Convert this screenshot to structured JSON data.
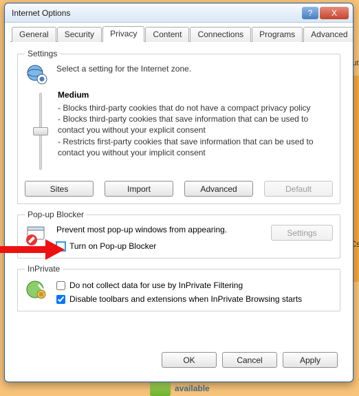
{
  "window": {
    "title": "Internet Options",
    "help": "?",
    "close": "X"
  },
  "tabs": [
    "General",
    "Security",
    "Privacy",
    "Content",
    "Connections",
    "Programs",
    "Advanced"
  ],
  "settings": {
    "legend": "Settings",
    "zone_text": "Select a setting for the Internet zone.",
    "level": "Medium",
    "bullets": [
      "- Blocks third-party cookies that do not have a compact privacy policy",
      "- Blocks third-party cookies that save information that can be used to contact you without your explicit consent",
      "- Restricts first-party cookies that save information that can be used to contact you without your implicit consent"
    ],
    "buttons": {
      "sites": "Sites",
      "import": "Import",
      "advanced": "Advanced",
      "default": "Default"
    }
  },
  "popup": {
    "legend": "Pop-up Blocker",
    "desc": "Prevent most pop-up windows from appearing.",
    "settings_btn": "Settings",
    "turn_on": "Turn on Pop-up Blocker",
    "turn_on_checked": false
  },
  "inprivate": {
    "legend": "InPrivate",
    "opt1": "Do not collect data for use by InPrivate Filtering",
    "opt1_checked": false,
    "opt2": "Disable toolbars and extensions when InPrivate Browsing starts",
    "opt2_checked": true
  },
  "dialog_buttons": {
    "ok": "OK",
    "cancel": "Cancel",
    "apply": "Apply"
  },
  "bg": {
    "avail": "available",
    "cs": "Cs",
    "uti": "uti"
  }
}
